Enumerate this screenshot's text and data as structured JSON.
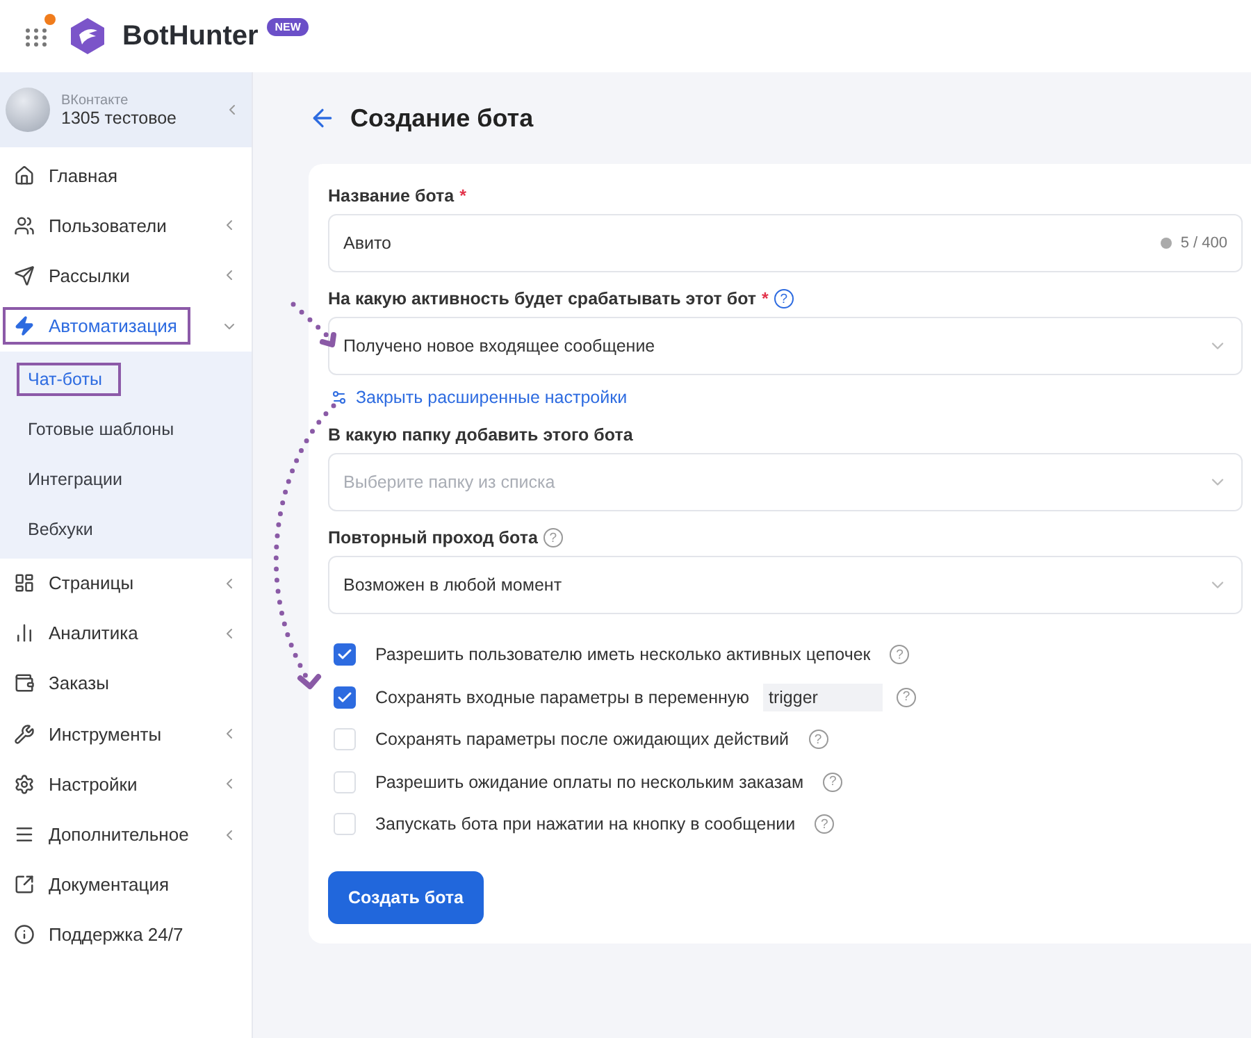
{
  "header": {
    "logo_text": "BotHunter",
    "badge": "NEW",
    "notification_dot": true
  },
  "account": {
    "network": "ВКонтакте",
    "name": "1305 тестовое"
  },
  "nav": [
    {
      "label": "Главная",
      "has_submenu": false,
      "expanded": false,
      "selected": false,
      "highlighted": false
    },
    {
      "label": "Пользователи",
      "has_submenu": true,
      "expanded": false,
      "selected": false,
      "highlighted": false
    },
    {
      "label": "Рассылки",
      "has_submenu": true,
      "expanded": false,
      "selected": false,
      "highlighted": false
    },
    {
      "label": "Автоматизация",
      "has_submenu": true,
      "expanded": true,
      "selected": true,
      "highlighted": true,
      "children": [
        {
          "label": "Чат-боты",
          "selected": true,
          "highlighted": true
        },
        {
          "label": "Готовые шаблоны",
          "selected": false,
          "highlighted": false
        },
        {
          "label": "Интеграции",
          "selected": false,
          "highlighted": false
        },
        {
          "label": "Вебхуки",
          "selected": false,
          "highlighted": false
        }
      ]
    },
    {
      "label": "Страницы",
      "has_submenu": true,
      "expanded": false,
      "selected": false,
      "highlighted": false
    },
    {
      "label": "Аналитика",
      "has_submenu": true,
      "expanded": false,
      "selected": false,
      "highlighted": false
    },
    {
      "label": "Заказы",
      "has_submenu": false,
      "expanded": false,
      "selected": false,
      "highlighted": false
    },
    {
      "label": "Инструменты",
      "has_submenu": true,
      "expanded": false,
      "selected": false,
      "highlighted": false
    },
    {
      "label": "Настройки",
      "has_submenu": true,
      "expanded": false,
      "selected": false,
      "highlighted": false
    },
    {
      "label": "Дополнительное",
      "has_submenu": true,
      "expanded": false,
      "selected": false,
      "highlighted": false
    },
    {
      "label": "Документация",
      "has_submenu": false,
      "expanded": false,
      "selected": false,
      "highlighted": false
    },
    {
      "label": "Поддержка 24/7",
      "has_submenu": false,
      "expanded": false,
      "selected": false,
      "highlighted": false
    }
  ],
  "page_title": "Создание бота",
  "form": {
    "name_field": {
      "label": "Название бота",
      "required_mark": "*",
      "value": "Авито",
      "counter": "5 / 400"
    },
    "trigger_field": {
      "label": "На какую активность будет срабатывать этот бот",
      "required_mark": "*",
      "help": "?",
      "value": "Получено новое входящее сообщение"
    },
    "advanced_link": "Закрыть расширенные настройки",
    "folder_field": {
      "label": "В какую папку добавить этого бота",
      "placeholder": "Выберите папку из списка"
    },
    "repeat_field": {
      "label": "Повторный проход бота",
      "help": "?",
      "value": "Возможен в любой момент"
    },
    "options": [
      {
        "kind": "plain",
        "label": "Разрешить пользователю иметь несколько активных цепочек",
        "checked": true,
        "help": "?"
      },
      {
        "kind": "variable",
        "label": "Сохранять входные параметры в переменную",
        "checked": true,
        "variable": "trigger",
        "help": "?"
      },
      {
        "kind": "plain",
        "label": "Сохранять параметры после ожидающих действий",
        "checked": false,
        "help": "?"
      },
      {
        "kind": "plain",
        "label": "Разрешить ожидание оплаты по нескольким заказам",
        "checked": false,
        "help": "?"
      },
      {
        "kind": "plain",
        "label": "Запускать бота при нажатии на кнопку в сообщении",
        "checked": false,
        "help": "?"
      }
    ],
    "submit": "Создать бота"
  },
  "arrows": [
    {
      "kind": "dotted"
    },
    {
      "kind": "dotted"
    }
  ]
}
